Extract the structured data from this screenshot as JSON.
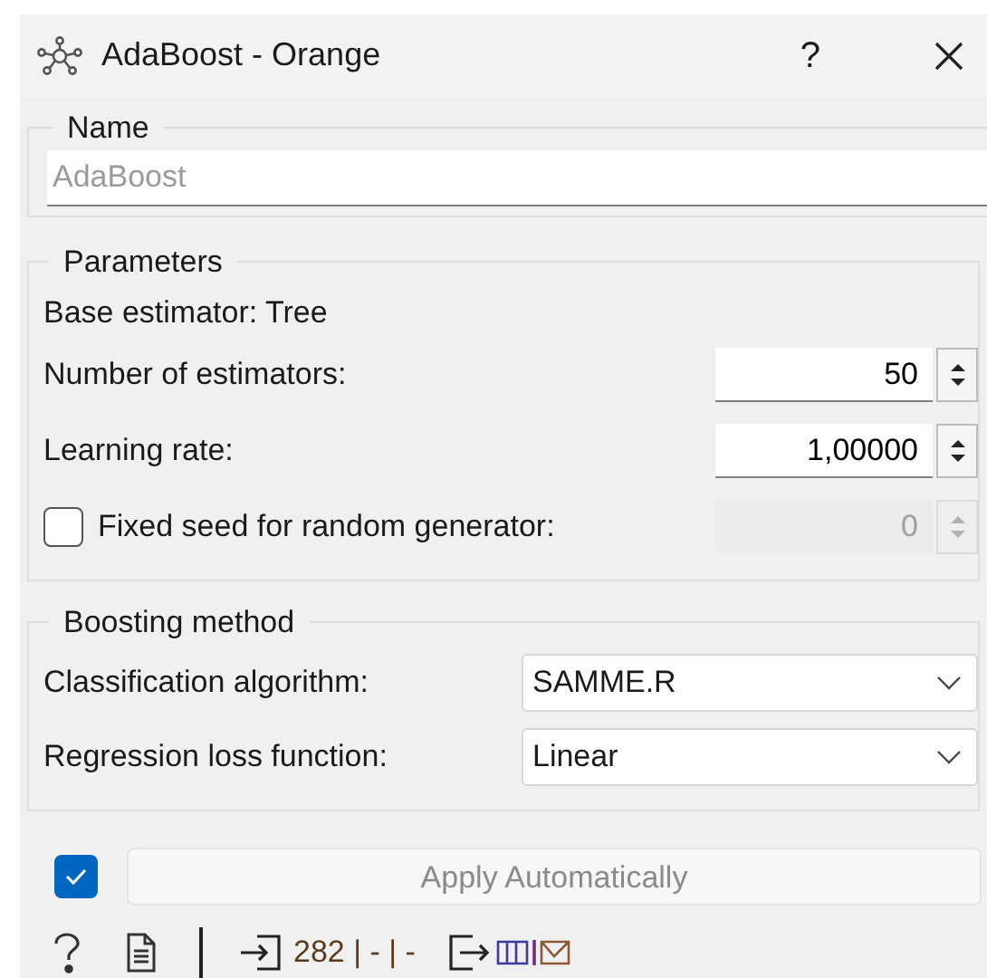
{
  "window": {
    "title": "AdaBoost - Orange",
    "help": "?"
  },
  "name_group": {
    "title": "Name",
    "field": {
      "placeholder": "AdaBoost"
    }
  },
  "parameters": {
    "title": "Parameters",
    "base_estimator": "Base estimator: Tree",
    "rows": [
      {
        "kind": "spin",
        "label": "Number of estimators:",
        "value": "50",
        "disabled": false
      },
      {
        "kind": "spin",
        "label": "Learning rate:",
        "value": "1,00000",
        "disabled": false
      },
      {
        "kind": "check_spin",
        "label": "Fixed seed for random generator:",
        "checked": false,
        "value": "0",
        "disabled": true
      }
    ]
  },
  "boosting": {
    "title": "Boosting method",
    "rows": [
      {
        "label": "Classification algorithm:",
        "value": "SAMME.R"
      },
      {
        "label": "Regression loss function:",
        "value": "Linear"
      }
    ]
  },
  "apply": {
    "checked": true,
    "label": "Apply Automatically",
    "disabled": true
  },
  "status": {
    "input_summary": "282 | - | -"
  }
}
